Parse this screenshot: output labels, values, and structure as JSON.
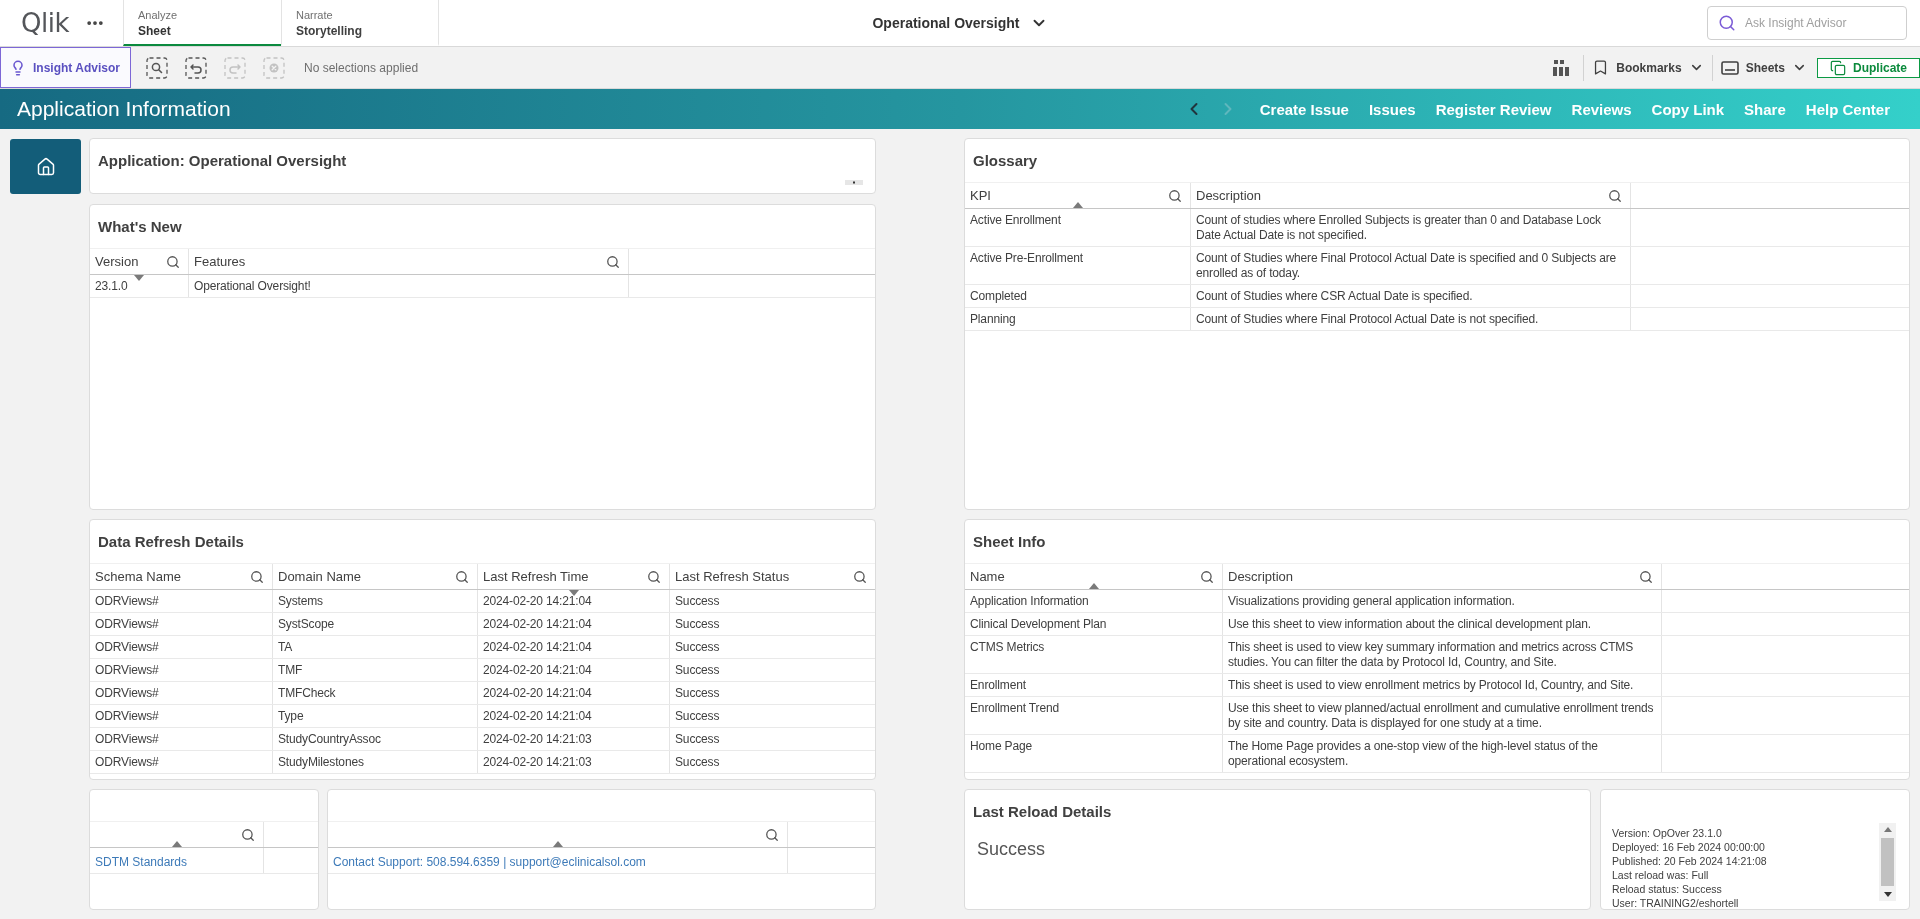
{
  "top_bar": {
    "logo": "Qlik",
    "tabs": [
      {
        "label": "Analyze",
        "title": "Sheet",
        "selected": true
      },
      {
        "label": "Narrate",
        "title": "Storytelling",
        "selected": false
      }
    ],
    "app_title": "Operational Oversight",
    "search": {
      "placeholder": "Ask Insight Advisor"
    }
  },
  "toolbar": {
    "insight_advisor": "Insight Advisor",
    "selection_tools": [
      {
        "kind": "smart_search",
        "disabled": false
      },
      {
        "kind": "step_back",
        "disabled": false
      },
      {
        "kind": "step_forward",
        "disabled": true
      },
      {
        "kind": "clear_all",
        "disabled": true
      }
    ],
    "selections": "No selections applied",
    "bookmarks": "Bookmarks",
    "sheets": "Sheets",
    "duplicate": "Duplicate"
  },
  "banner": {
    "title": "Application Information",
    "nav": [
      {
        "kind": "previous",
        "disabled": false
      },
      {
        "kind": "next",
        "disabled": true
      }
    ],
    "links": [
      "Create Issue",
      "Issues",
      "Register Review",
      "Reviews",
      "Copy Link",
      "Share",
      "Help Center"
    ]
  },
  "application": {
    "title": "Application: Operational Oversight"
  },
  "whats_new": {
    "title": "What's New",
    "columns": [
      {
        "label": "Version",
        "sorted": true,
        "descending": true
      },
      {
        "label": "Features",
        "sorted": false
      }
    ],
    "rows": [
      [
        "23.1.0",
        "Operational Oversight!"
      ]
    ]
  },
  "data_refresh": {
    "title": "Data Refresh Details",
    "columns": [
      {
        "label": "Schema Name",
        "sorted": false
      },
      {
        "label": "Domain Name",
        "sorted": false
      },
      {
        "label": "Last Refresh Time",
        "sorted": true,
        "descending": true
      },
      {
        "label": "Last Refresh Status",
        "sorted": false
      }
    ],
    "rows": [
      [
        "ODRViews#",
        "Systems",
        "2024-02-20 14:21:04",
        "Success"
      ],
      [
        "ODRViews#",
        "SystScope",
        "2024-02-20 14:21:04",
        "Success"
      ],
      [
        "ODRViews#",
        "TA",
        "2024-02-20 14:21:04",
        "Success"
      ],
      [
        "ODRViews#",
        "TMF",
        "2024-02-20 14:21:04",
        "Success"
      ],
      [
        "ODRViews#",
        "TMFCheck",
        "2024-02-20 14:21:04",
        "Success"
      ],
      [
        "ODRViews#",
        "Type",
        "2024-02-20 14:21:04",
        "Success"
      ],
      [
        "ODRViews#",
        "StudyCountryAssoc",
        "2024-02-20 14:21:03",
        "Success"
      ],
      [
        "ODRViews#",
        "StudyMilestones",
        "2024-02-20 14:21:03",
        "Success"
      ]
    ]
  },
  "glossary": {
    "title": "Glossary",
    "columns": [
      {
        "label": "KPI",
        "sorted": true,
        "descending": false
      },
      {
        "label": "Description",
        "sorted": false
      }
    ],
    "rows": [
      [
        "Active Enrollment",
        "Count of studies where Enrolled Subjects is greater than 0 and Database Lock Date Actual Date is not specified."
      ],
      [
        "Active Pre-Enrollment",
        "Count of Studies where Final Protocol Actual Date is specified and 0 Subjects are enrolled as of today."
      ],
      [
        "Completed",
        "Count of Studies where CSR Actual Date is specified."
      ],
      [
        "Planning",
        "Count of Studies where Final Protocol Actual Date is not specified."
      ]
    ]
  },
  "sheet_info": {
    "title": "Sheet Info",
    "columns": [
      {
        "label": "Name",
        "sorted": true,
        "descending": false
      },
      {
        "label": "Description",
        "sorted": false
      }
    ],
    "rows": [
      [
        "Application Information",
        "Visualizations providing general application information."
      ],
      [
        "Clinical Development Plan",
        "Use this sheet to view information about the clinical development plan."
      ],
      [
        "CTMS Metrics",
        "This sheet is used to view key summary information and metrics across CTMS studies. You can filter the data by Protocol Id, Country, and Site."
      ],
      [
        "Enrollment",
        "This sheet is used to view enrollment metrics by Protocol Id, Country, and Site."
      ],
      [
        "Enrollment Trend",
        "Use this sheet to view planned/actual enrollment and cumulative enrollment trends by site and country. Data is displayed for one study at a time."
      ],
      [
        "Home Page",
        "The Home Page provides a one-stop view of the high-level status of the operational ecosystem."
      ]
    ]
  },
  "link_tables": [
    {
      "columns": [
        {
          "sorted": true,
          "descending": false
        }
      ],
      "links": [
        "SDTM Standards"
      ]
    },
    {
      "columns": [
        {
          "sorted": true,
          "descending": false
        }
      ],
      "links": [
        "Contact Support: 508.594.6359 | support@eclinicalsol.com"
      ]
    }
  ],
  "last_reload": {
    "title": "Last Reload Details",
    "status": "Success"
  },
  "version_info": {
    "lines": [
      "Version: OpOver 23.1.0",
      "Deployed: 16 Feb 2024 00:00:00",
      "Published: 20 Feb 2024 14:21:08",
      "Last reload was: Full",
      "Reload status: Success",
      "User: TRAINING2/eshortell"
    ]
  }
}
